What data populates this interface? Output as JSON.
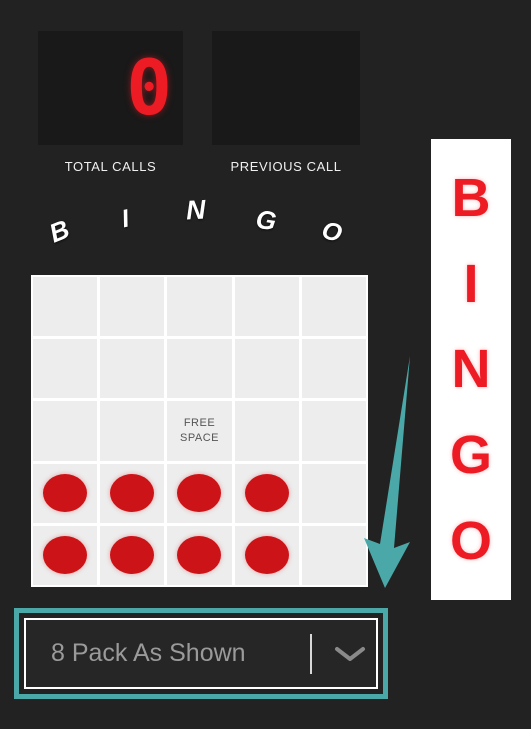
{
  "app": {
    "background_color": "#222222",
    "accent_teal": "#4BA8A8",
    "accent_red": "#ED1C24",
    "daub_color": "#CC1418"
  },
  "displays": {
    "total_calls": {
      "label": "TOTAL CALLS",
      "value": "0"
    },
    "previous_call": {
      "label": "PREVIOUS CALL",
      "value": ""
    }
  },
  "card_header": {
    "letters": [
      "B",
      "I",
      "N",
      "G",
      "O"
    ]
  },
  "card": {
    "free_space_line1": "FREE",
    "free_space_line2": "SPACE",
    "rows": [
      [
        {
          "marked": false,
          "free": false
        },
        {
          "marked": false,
          "free": false
        },
        {
          "marked": false,
          "free": false
        },
        {
          "marked": false,
          "free": false
        },
        {
          "marked": false,
          "free": false
        }
      ],
      [
        {
          "marked": false,
          "free": false
        },
        {
          "marked": false,
          "free": false
        },
        {
          "marked": false,
          "free": false
        },
        {
          "marked": false,
          "free": false
        },
        {
          "marked": false,
          "free": false
        }
      ],
      [
        {
          "marked": false,
          "free": false
        },
        {
          "marked": false,
          "free": false
        },
        {
          "marked": false,
          "free": true
        },
        {
          "marked": false,
          "free": false
        },
        {
          "marked": false,
          "free": false
        }
      ],
      [
        {
          "marked": true,
          "free": false
        },
        {
          "marked": true,
          "free": false
        },
        {
          "marked": true,
          "free": false
        },
        {
          "marked": true,
          "free": false
        },
        {
          "marked": false,
          "free": false
        }
      ],
      [
        {
          "marked": true,
          "free": false
        },
        {
          "marked": true,
          "free": false
        },
        {
          "marked": true,
          "free": false
        },
        {
          "marked": true,
          "free": false
        },
        {
          "marked": false,
          "free": false
        }
      ]
    ]
  },
  "pack_selector": {
    "value": "8 Pack As Shown",
    "chevron_icon": "chevron-down-icon",
    "highlight_color": "#4BA8A8"
  },
  "side_banner": {
    "letters": [
      "B",
      "I",
      "N",
      "G",
      "O"
    ],
    "text_color": "#ED1C24",
    "background_color": "#ffffff"
  },
  "pointer": {
    "icon": "arrow-down-left-icon",
    "color": "#4BA8A8"
  }
}
